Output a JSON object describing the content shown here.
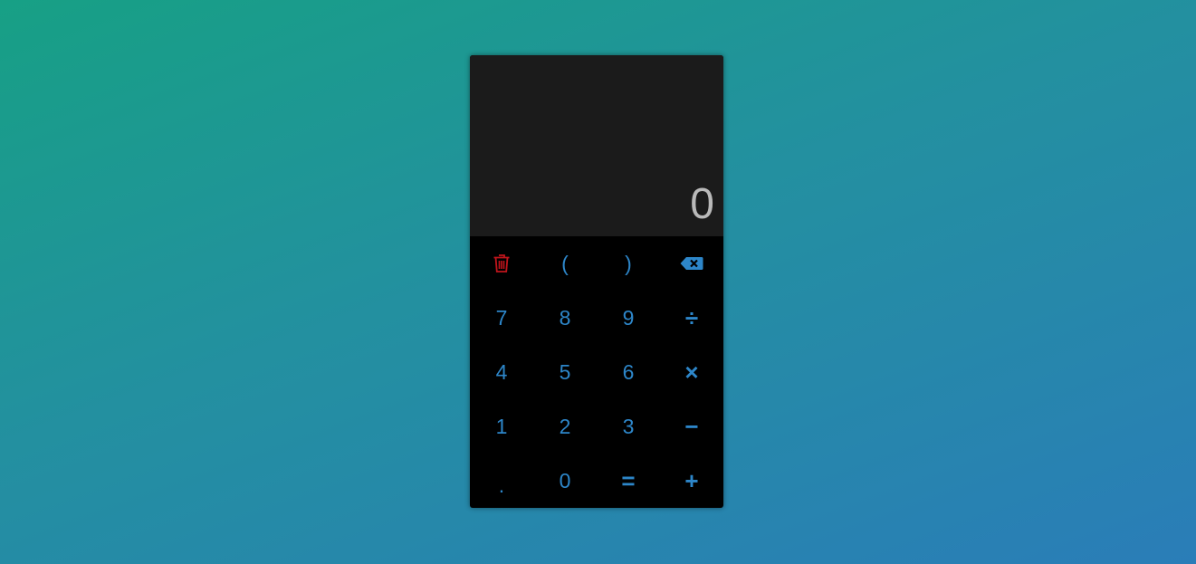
{
  "display": {
    "value": "0"
  },
  "keys": {
    "open_paren": "(",
    "close_paren": ")",
    "seven": "7",
    "eight": "8",
    "nine": "9",
    "divide": "÷",
    "four": "4",
    "five": "5",
    "six": "6",
    "multiply": "×",
    "one": "1",
    "two": "2",
    "three": "3",
    "subtract": "−",
    "dot": ".",
    "zero": "0",
    "equals": "=",
    "add": "+"
  },
  "icons": {
    "clear": "trash-icon",
    "backspace": "backspace-icon"
  },
  "colors": {
    "key_text": "#2d86c9",
    "clear_icon": "#c0141b",
    "display_bg": "#1b1b1b",
    "display_text": "#b9b9b9",
    "keypad_bg": "#000000"
  }
}
